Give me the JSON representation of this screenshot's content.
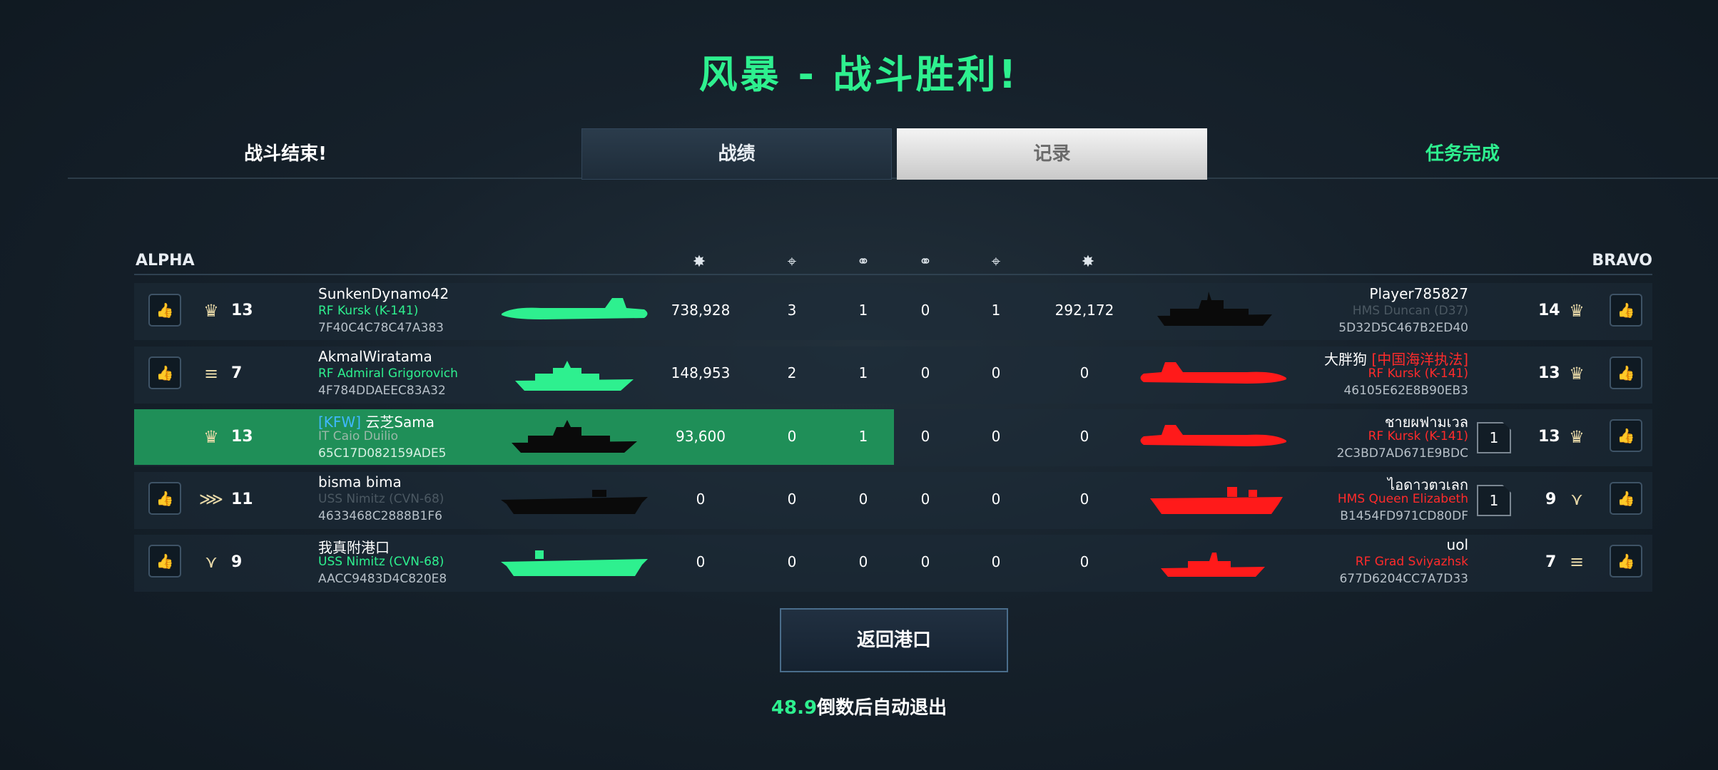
{
  "title": "风暴 - 战斗胜利!",
  "tabs": {
    "end": "战斗结束!",
    "stats": "战绩",
    "record": "记录",
    "mission": "任务完成"
  },
  "teams": {
    "alpha": "ALPHA",
    "bravo": "BRAVO"
  },
  "column_icons": [
    "damage-dealt",
    "kills",
    "assists",
    "assists",
    "kills",
    "damage-dealt"
  ],
  "alpha": [
    {
      "level": "13",
      "name": "SunkenDynamo42",
      "ship": "RF Kursk (K-141)",
      "id": "7F40C4C78C47A383",
      "damage": "738,928",
      "kills": "3",
      "assists": "1",
      "ship_color": "green"
    },
    {
      "level": "7",
      "name": "AkmalWiratama",
      "ship": "RF Admiral Grigorovich",
      "id": "4F784DDAEEC83A32",
      "damage": "148,953",
      "kills": "2",
      "assists": "1",
      "ship_color": "green"
    },
    {
      "level": "13",
      "tag": "[KFW]",
      "name": "云芝Sama",
      "ship": "IT Caio Duilio",
      "id": "65C17D082159ADE5",
      "damage": "93,600",
      "kills": "0",
      "assists": "1",
      "ship_color": "black"
    },
    {
      "level": "11",
      "name": "bisma bima",
      "ship": "USS Nimitz (CVN-68)",
      "id": "4633468C2888B1F6",
      "damage": "0",
      "kills": "0",
      "assists": "0",
      "ship_color": "black"
    },
    {
      "level": "9",
      "name": "我真附港口",
      "ship": "USS Nimitz (CVN-68)",
      "id": "AACC9483D4C820E8",
      "damage": "0",
      "kills": "0",
      "assists": "0",
      "ship_color": "green"
    }
  ],
  "bravo": [
    {
      "level": "14",
      "name": "Player785827",
      "ship": "HMS Duncan (D37)",
      "id": "5D32D5C467B2ED40",
      "assists": "0",
      "kills": "1",
      "damage": "292,172",
      "ship_color": "black"
    },
    {
      "level": "13",
      "name": "大胖狗",
      "tag": "[中国海洋执法]",
      "ship": "RF Kursk (K-141)",
      "id": "46105E62E8B90EB3",
      "assists": "0",
      "kills": "0",
      "damage": "0",
      "ship_color": "red"
    },
    {
      "level": "13",
      "name": "ชายผฟามเวล",
      "ship": "RF Kursk (K-141)",
      "id": "2C3BD7AD671E9BDC",
      "assists": "0",
      "kills": "0",
      "damage": "0",
      "ship_color": "red",
      "flag": "1"
    },
    {
      "level": "9",
      "name": "ไอดาวตวเลก",
      "ship": "HMS Queen Elizabeth",
      "id": "B1454FD971CD80DF",
      "assists": "0",
      "kills": "0",
      "damage": "0",
      "ship_color": "red",
      "flag": "1"
    },
    {
      "level": "7",
      "name": "uol",
      "ship": "RF Grad Sviyazhsk",
      "id": "677D6204CC7A7D33",
      "assists": "0",
      "kills": "0",
      "damage": "0",
      "ship_color": "red"
    }
  ],
  "return_button": "返回港口",
  "countdown": {
    "seconds": "48.9",
    "text": "倒数后自动退出"
  },
  "colors": {
    "green": "#2ef08f",
    "red": "#ff1a1a",
    "highlight": "#1f8f58"
  }
}
